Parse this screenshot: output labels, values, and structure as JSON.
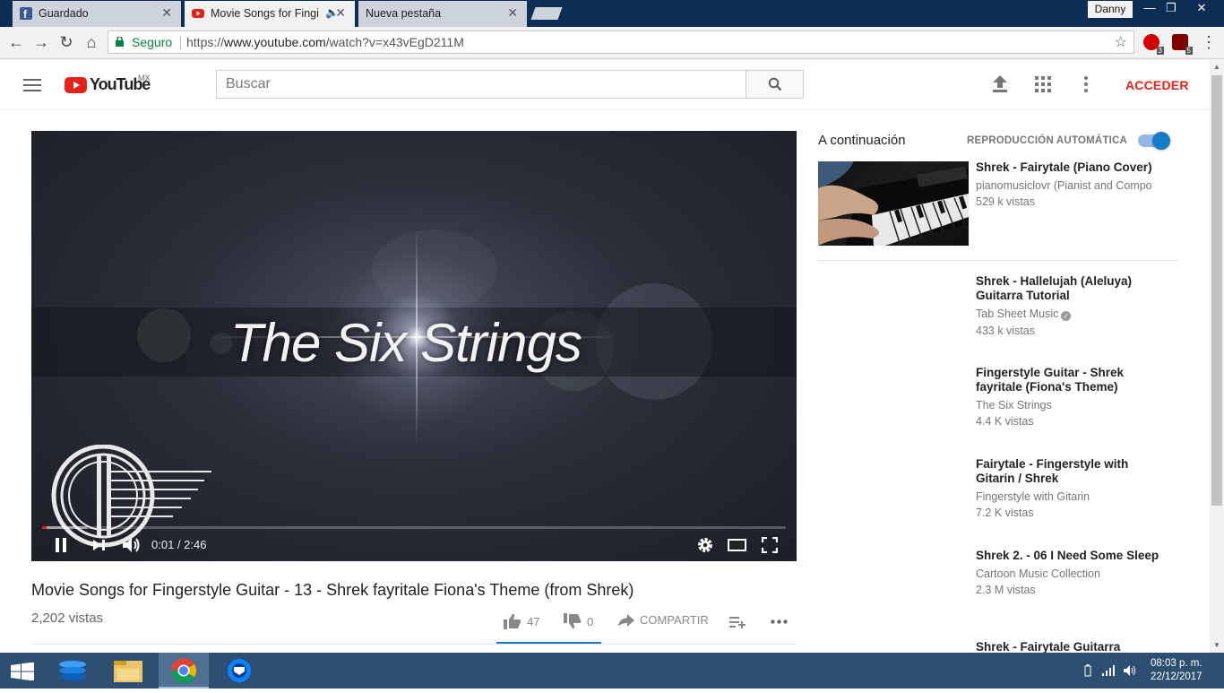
{
  "browser": {
    "tabs": [
      {
        "title": "Guardado",
        "favicon": "facebook-icon"
      },
      {
        "title": "Movie Songs for Fingi",
        "favicon": "youtube-icon",
        "audio": true
      },
      {
        "title": "Nueva pestaña",
        "favicon": "none"
      }
    ],
    "user": "Danny",
    "secure_label": "Seguro",
    "url_scheme": "https://",
    "url_host": "www.youtube.com",
    "url_path": "/watch?v=x43vEgD211M",
    "extensions": [
      {
        "name": "adblock-icon",
        "badge": "3"
      },
      {
        "name": "ublock-icon",
        "badge": "5"
      }
    ]
  },
  "youtube": {
    "logo_text": "YouTube",
    "country": "MX",
    "search_placeholder": "Buscar",
    "signin": "ACCEDER"
  },
  "player": {
    "overlay_text": "The Six Strings",
    "time": "0:01 / 2:46",
    "progress_fraction": 0.006,
    "buffer_fraction": 0.06
  },
  "video": {
    "title": "Movie Songs for Fingerstyle Guitar - 13 - Shrek fayritale Fiona's Theme (from Shrek)",
    "views": "2,202 vistas",
    "likes": "47",
    "dislikes": "0",
    "share": "COMPARTIR"
  },
  "sidebar": {
    "up_next": "A continuación",
    "autoplay": "REPRODUCCIÓN AUTOMÁTICA",
    "items": [
      {
        "title": "Shrek - Fairytale (Piano Cover)",
        "channel": "pianomusiclovr (Pianist and Compo",
        "views": "529 k vistas"
      },
      {
        "title": "Shrek - Hallelujah (Aleluya) Guitarra Tutorial",
        "channel": "Tab Sheet Music",
        "views": "433 k vistas"
      },
      {
        "title": "Fingerstyle Guitar - Shrek fayritale (Fiona's Theme)",
        "channel": "The Six Strings",
        "views": "4.4 K vistas"
      },
      {
        "title": "Fairytale - Fingerstyle with Gitarin / Shrek",
        "channel": "Fingerstyle with Gitarin",
        "views": "7.2 K vistas"
      },
      {
        "title": "Shrek 2. - 06 I Need Some Sleep",
        "channel": "Cartoon Music Collection",
        "views": "2.3 M vistas"
      },
      {
        "title": "Shrek - Fairytale Guitarra",
        "channel": "",
        "views": ""
      }
    ]
  },
  "taskbar": {
    "time": "08:03 p. m.",
    "date": "22/12/2017"
  },
  "colors": {
    "yt_red": "#e62117",
    "accent_blue": "#167ac6",
    "tab_bg": "#0c2d55",
    "taskbar": "#2d4f72"
  }
}
